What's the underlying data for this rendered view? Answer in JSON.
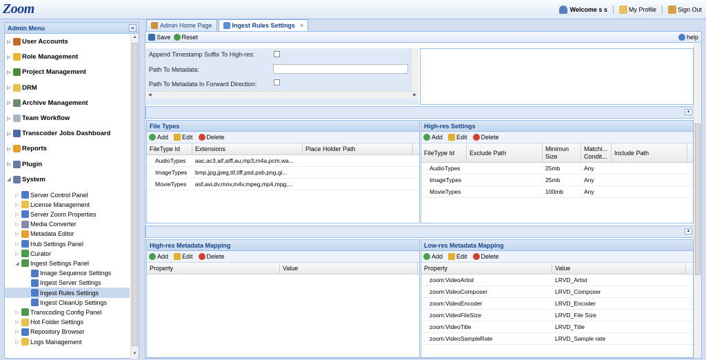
{
  "app": {
    "logo": "Zoom"
  },
  "header": {
    "welcome": "Welcome s s",
    "profile": "My Profile",
    "signout": "Sign Out"
  },
  "sidebar": {
    "title": "Admin Menu",
    "collapse": "«",
    "items": [
      {
        "label": "User Accounts",
        "level": 0,
        "color": "#c46a2a"
      },
      {
        "label": "Role Management",
        "level": 0,
        "color": "#e8b530"
      },
      {
        "label": "Project Management",
        "level": 0,
        "color": "#4a8a3a"
      },
      {
        "label": "DRM",
        "level": 0,
        "color": "#e7c14a"
      },
      {
        "label": "Archive Management",
        "level": 0,
        "color": "#6a8a6a"
      },
      {
        "label": "Team Workflow",
        "level": 0,
        "color": "#aab6c8"
      },
      {
        "label": "Transcoder Jobs Dashboard",
        "level": 0,
        "color": "#4a6aa8"
      },
      {
        "label": "Reports",
        "level": 0,
        "color": "#e7a02a"
      },
      {
        "label": "Plugin",
        "level": 0,
        "color": "#6a7aa8"
      },
      {
        "label": "System",
        "level": 0,
        "color": "#6a7aa8"
      },
      {
        "label": "Server Control Panel",
        "level": 1,
        "color": "#4a7ac8"
      },
      {
        "label": "License Management",
        "level": 1,
        "color": "#e7c14a"
      },
      {
        "label": "Server Zoom Properties",
        "level": 1,
        "color": "#4a7ac8"
      },
      {
        "label": "Media Converter",
        "level": 1,
        "color": "#8a8aa8"
      },
      {
        "label": "Metadata Editor",
        "level": 1,
        "color": "#e7a02a"
      },
      {
        "label": "Hub Settings Panel",
        "level": 1,
        "color": "#4a7ac8"
      },
      {
        "label": "Curator",
        "level": 1,
        "color": "#4a9a4a"
      },
      {
        "label": "Ingest Settings Panel",
        "level": 1,
        "color": "#4a9a4a"
      },
      {
        "label": "Image Sequence Settings",
        "level": 2,
        "color": "#4a7ac8"
      },
      {
        "label": "Ingest Server Settings",
        "level": 2,
        "color": "#4a7ac8"
      },
      {
        "label": "Ingest Rules Settings",
        "level": 2,
        "color": "#4a7ac8"
      },
      {
        "label": "Ingest CleanUp Settings",
        "level": 2,
        "color": "#4a7ac8"
      },
      {
        "label": "Transcoding Config Panel",
        "level": 1,
        "color": "#4a9a4a"
      },
      {
        "label": "Hot Folder Settings",
        "level": 1,
        "color": "#e7c14a"
      },
      {
        "label": "Repository Browser",
        "level": 1,
        "color": "#4a7ac8"
      },
      {
        "label": "Logs Management",
        "level": 1,
        "color": "#e7c14a"
      }
    ]
  },
  "tabs": [
    {
      "label": "Admin Home Page"
    },
    {
      "label": "Ingest Rules Settings"
    }
  ],
  "tab_close": "×",
  "toolbar": {
    "save": "Save",
    "reset": "Reset",
    "help": "help"
  },
  "form": {
    "timestamp_label": "Append Timestamp Suffix To High-res:",
    "path_label": "Path To Metadata:",
    "path_value": "",
    "forward_label": "Path To Metadata In Forward Direction:"
  },
  "actions": {
    "add": "Add",
    "edit": "Edit",
    "delete": "Delete"
  },
  "file_types": {
    "title": "File Types",
    "columns": [
      "FileType Id",
      "Extensions",
      "Place Holder Path"
    ],
    "rows": [
      [
        "AudioTypes",
        "aac,ac3,aif,aiff,au,mp3,m4a,pcm,wa...",
        ""
      ],
      [
        "ImageTypes",
        "bmp,jpg,jpeg,tif,tiff,psd,psb,png,gi...",
        ""
      ],
      [
        "MovieTypes",
        "asf,avi,dv,mov,m4v,mpeg,mp4,mpg,...",
        ""
      ]
    ]
  },
  "highres_settings": {
    "title": "High-res Settings",
    "columns": [
      "FileType Id",
      "Exclude Path",
      "Minimun Size",
      "Matchi... Condit...",
      "Include Path"
    ],
    "rows": [
      [
        "AudioTypes",
        "",
        "25mb",
        "Any",
        ""
      ],
      [
        "ImageTypes",
        "",
        "25mb",
        "Any",
        ""
      ],
      [
        "MovieTypes",
        "",
        "100mb",
        "Any",
        ""
      ]
    ]
  },
  "highres_mapping": {
    "title": "High-res Metadata Mapping",
    "columns": [
      "Property",
      "Value"
    ]
  },
  "lowres_mapping": {
    "title": "Low-res Metadata Mapping",
    "columns": [
      "Property",
      "Value"
    ],
    "rows": [
      [
        "zoom:VideoArtist",
        "LRVD_Artist"
      ],
      [
        "zoom:VideoComposer",
        "LRVD_Composer"
      ],
      [
        "zoom:VideoEncoder",
        "LRVD_Encoder"
      ],
      [
        "zoom:VideoFileSize",
        "LRVD_File Size"
      ],
      [
        "zoom:VideoTitle",
        "LRVD_Title"
      ],
      [
        "zoom:VideoSampleRate",
        "LRVD_Sample rate"
      ]
    ]
  }
}
